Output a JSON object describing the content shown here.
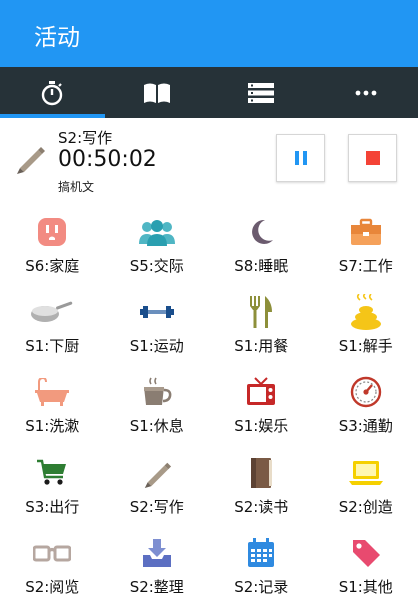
{
  "app": {
    "title": "活动"
  },
  "tabs": [
    {
      "icon": "timer-icon",
      "selected": true
    },
    {
      "icon": "book-icon",
      "selected": false
    },
    {
      "icon": "list-icon",
      "selected": false
    },
    {
      "icon": "more-icon",
      "selected": false
    }
  ],
  "current": {
    "name": "S2:写作",
    "elapsed": "00:50:02",
    "note": "搞机文"
  },
  "colors": {
    "appbar": "#2196f3",
    "tabbar": "#263238",
    "indicator": "#2196f3",
    "stop": "#f44336",
    "pause": "#2196f3"
  },
  "activities": [
    {
      "label": "S6:家庭",
      "icon": "outlet-icon"
    },
    {
      "label": "S5:交际",
      "icon": "people-icon"
    },
    {
      "label": "S8:睡眠",
      "icon": "moon-icon"
    },
    {
      "label": "S7:工作",
      "icon": "briefcase-icon"
    },
    {
      "label": "S1:下厨",
      "icon": "frying-pan-icon"
    },
    {
      "label": "S1:运动",
      "icon": "dumbbell-icon"
    },
    {
      "label": "S1:用餐",
      "icon": "fork-knife-icon"
    },
    {
      "label": "S1:解手",
      "icon": "poop-icon"
    },
    {
      "label": "S1:洗漱",
      "icon": "bathtub-icon"
    },
    {
      "label": "S1:休息",
      "icon": "coffee-cup-icon"
    },
    {
      "label": "S1:娱乐",
      "icon": "tv-icon"
    },
    {
      "label": "S3:通勤",
      "icon": "speedometer-icon"
    },
    {
      "label": "S3:出行",
      "icon": "shopping-cart-icon"
    },
    {
      "label": "S2:写作",
      "icon": "pencil-icon"
    },
    {
      "label": "S2:读书",
      "icon": "book-icon"
    },
    {
      "label": "S2:创造",
      "icon": "laptop-icon"
    },
    {
      "label": "S2:阅览",
      "icon": "glasses-icon"
    },
    {
      "label": "S2:整理",
      "icon": "inbox-tray-icon"
    },
    {
      "label": "S2:记录",
      "icon": "calendar-icon"
    },
    {
      "label": "S1:其他",
      "icon": "tag-icon"
    }
  ]
}
